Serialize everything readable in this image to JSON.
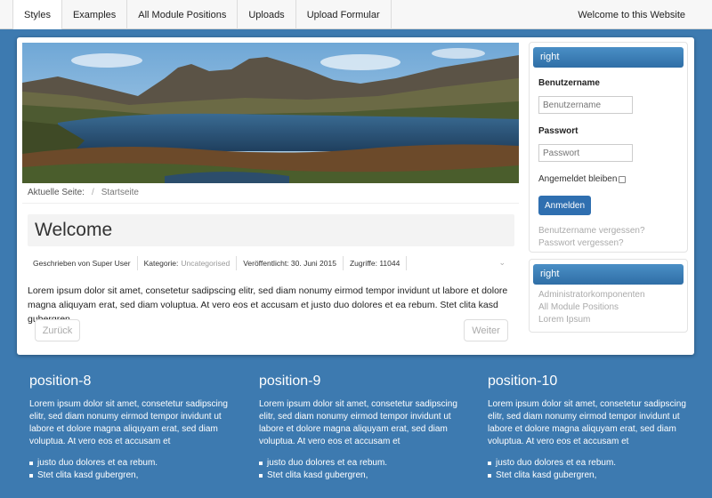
{
  "nav": {
    "tabs": [
      {
        "label": "Styles"
      },
      {
        "label": "Examples"
      },
      {
        "label": "All Module Positions"
      },
      {
        "label": "Uploads"
      },
      {
        "label": "Upload Formular"
      }
    ],
    "welcome": "Welcome to this Website"
  },
  "breadcrumb": {
    "current_label": "Aktuelle Seite:",
    "separator": "/",
    "home": "Startseite"
  },
  "article": {
    "title": "Welcome",
    "meta": {
      "author": "Geschrieben von Super User",
      "category_label": "Kategorie:",
      "category_value": "Uncategorised",
      "published": "Veröffentlicht: 30. Juni 2015",
      "hits": "Zugriffe: 11044"
    },
    "body": "Lorem ipsum dolor sit amet, consetetur sadipscing elitr, sed diam nonumy eirmod tempor invidunt ut labore et dolore magna aliquyam erat, sed diam voluptua. At vero eos et accusam et justo duo dolores et ea rebum. Stet clita kasd gubergren,",
    "prev": "Zurück",
    "next": "Weiter"
  },
  "login": {
    "title": "right",
    "username_label": "Benutzername",
    "username_placeholder": "Benutzername",
    "password_label": "Passwort",
    "password_placeholder": "Passwort",
    "remember": "Angemeldet bleiben",
    "submit": "Anmelden",
    "forgot_user": "Benutzername vergessen?",
    "forgot_pass": "Passwort vergessen?"
  },
  "menu": {
    "title": "right",
    "items": [
      "Administratorkomponenten",
      "All Module Positions",
      "Lorem Ipsum"
    ]
  },
  "positions": [
    {
      "title": "position-8",
      "text": "Lorem ipsum dolor sit amet, consetetur sadipscing elitr, sed diam nonumy eirmod tempor invidunt ut labore et dolore magna aliquyam erat, sed diam voluptua. At vero eos et accusam et",
      "items": [
        "justo duo dolores et ea rebum.",
        "Stet clita kasd gubergren,"
      ]
    },
    {
      "title": "position-9",
      "text": "Lorem ipsum dolor sit amet, consetetur sadipscing elitr, sed diam nonumy eirmod tempor invidunt ut labore et dolore magna aliquyam erat, sed diam voluptua. At vero eos et accusam et",
      "items": [
        "justo duo dolores et ea rebum.",
        "Stet clita kasd gubergren,"
      ]
    },
    {
      "title": "position-10",
      "text": "Lorem ipsum dolor sit amet, consetetur sadipscing elitr, sed diam nonumy eirmod tempor invidunt ut labore et dolore magna aliquyam erat, sed diam voluptua. At vero eos et accusam et",
      "items": [
        "justo duo dolores et ea rebum.",
        "Stet clita kasd gubergren,"
      ]
    }
  ],
  "colors": {
    "background": "#3d7ab0",
    "accent": "#2f6fb0",
    "module_header": "#3a7fb9"
  }
}
